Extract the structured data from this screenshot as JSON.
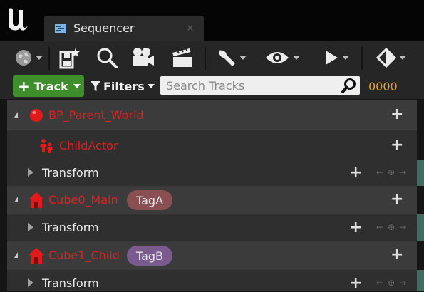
{
  "window": {
    "tab_title": "Sequencer",
    "tab_close_glyph": "×",
    "icons": {
      "logo": "unreal-logo-icon",
      "tab": "sequencer-icon"
    }
  },
  "toolbar": {
    "icons": [
      "world-icon",
      "save-as-icon",
      "find-icon",
      "camera-icon",
      "render-movie-icon",
      "settings-wrench-icon",
      "view-options-eye-icon",
      "playback-icon",
      "keyframe-icon"
    ]
  },
  "filterbar": {
    "add_track_label": "Track",
    "add_track_glyph": "+",
    "filters_label": "Filters",
    "search_placeholder": "Search Tracks",
    "search_value": "",
    "current_frame": "0000",
    "colors": {
      "track_button": "#3e8e2c",
      "frame_counter": "#e8a020"
    }
  },
  "tracks": {
    "bp_parent": {
      "label": "BP_Parent_World",
      "icon": "actor-sphere-icon"
    },
    "child_actor": {
      "label": "ChildActor",
      "icon": "child-actor-icon"
    },
    "transform_1": {
      "label": "Transform"
    },
    "cube0": {
      "label": "Cube0_Main",
      "tag": "TagA",
      "icon": "actor-house-icon"
    },
    "transform_2": {
      "label": "Transform"
    },
    "cube1": {
      "label": "Cube1_Child",
      "tag": "TagB",
      "icon": "actor-house-icon"
    },
    "transform_3": {
      "label": "Transform"
    },
    "colors": {
      "actor_label": "#e02020",
      "tag_a": "#8a4f52",
      "tag_b": "#7a5a8f",
      "section_bar": "#3e6b62"
    }
  }
}
